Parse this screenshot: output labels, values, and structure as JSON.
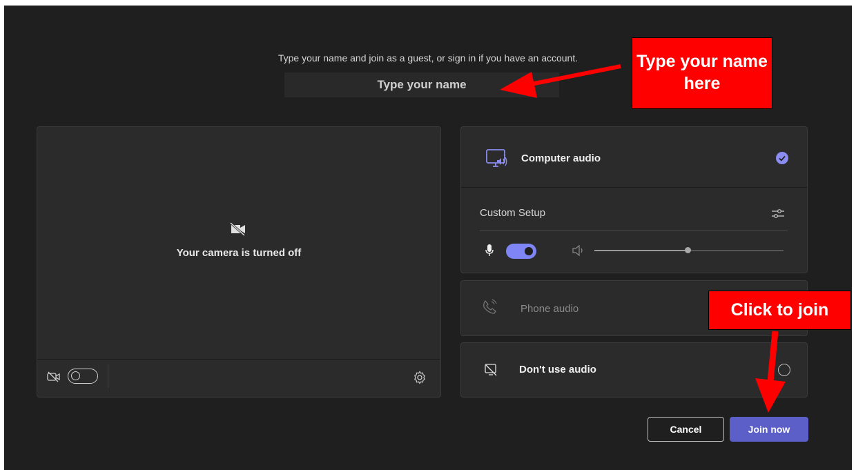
{
  "join": {
    "prompt": "Type your name and join as a guest, or sign in if you have an account.",
    "name_placeholder": "Type your name"
  },
  "preview": {
    "camera_message": "Your camera is turned off",
    "camera_toggle": "off"
  },
  "audio_options": {
    "computer": {
      "label": "Computer audio",
      "selected": true
    },
    "custom_setup_label": "Custom Setup",
    "mic_toggle": "on",
    "speaker_volume": 0.5,
    "phone": {
      "label": "Phone audio"
    },
    "none": {
      "label": "Don't use audio"
    }
  },
  "actions": {
    "cancel_label": "Cancel",
    "join_label": "Join now"
  },
  "annotations": {
    "name_callout": "Type your name here",
    "join_callout": "Click to join"
  },
  "colors": {
    "background": "#1f1f1f",
    "card": "#2b2b2b",
    "accent": "#5b5fc7",
    "accent_light": "#7f85f5",
    "callout": "#ff0000"
  }
}
